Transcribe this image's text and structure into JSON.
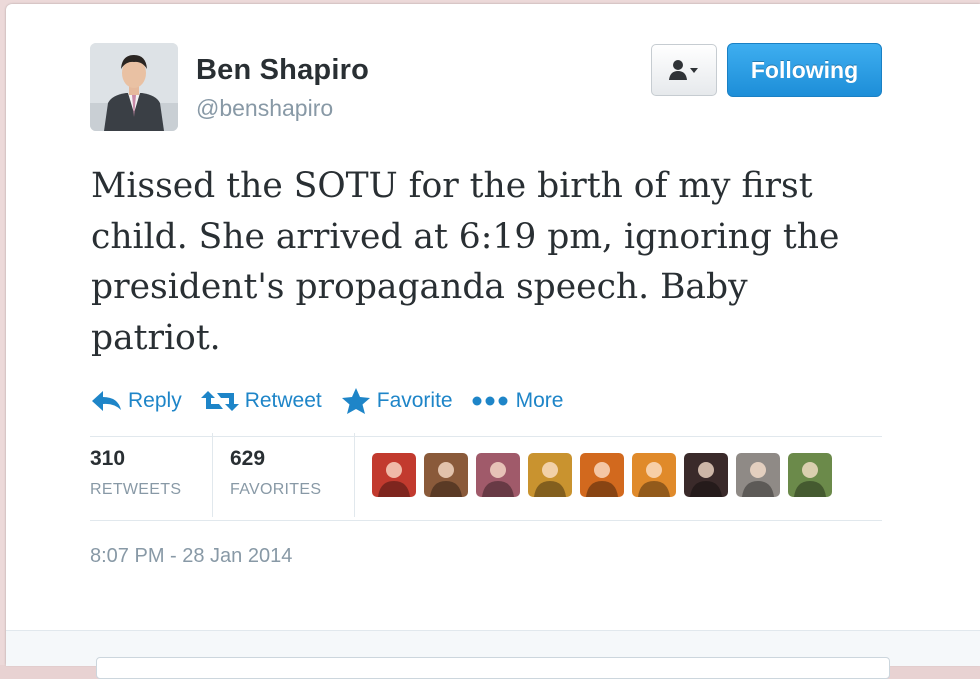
{
  "author": {
    "name": "Ben Shapiro",
    "handle": "@benshapiro",
    "avatar_icon": "profile-photo"
  },
  "header_buttons": {
    "user_menu_icon": "user-dropdown-icon",
    "follow_label": "Following"
  },
  "tweet": {
    "text": "Missed the SOTU for the birth of my first child. She arrived at 6:19 pm, ignoring the president's propaganda speech. Baby patriot."
  },
  "actions": {
    "reply": "Reply",
    "retweet": "Retweet",
    "favorite": "Favorite",
    "more": "More"
  },
  "stats": {
    "retweets_count": "310",
    "retweets_label": "RETWEETS",
    "favorites_count": "629",
    "favorites_label": "FAVORITES"
  },
  "favorited_by_colors": [
    "#c23a2e",
    "#8a5a3a",
    "#a05a6a",
    "#c9932f",
    "#d2691e",
    "#e08a2a",
    "#3a2a2a",
    "#8f8a86",
    "#6b8a4a"
  ],
  "timestamp": "8:07 PM - 28 Jan 2014",
  "colors": {
    "link": "#1e85c8",
    "follow_bg": "#2b9ee3",
    "muted": "#8899a6",
    "text": "#292f33"
  }
}
